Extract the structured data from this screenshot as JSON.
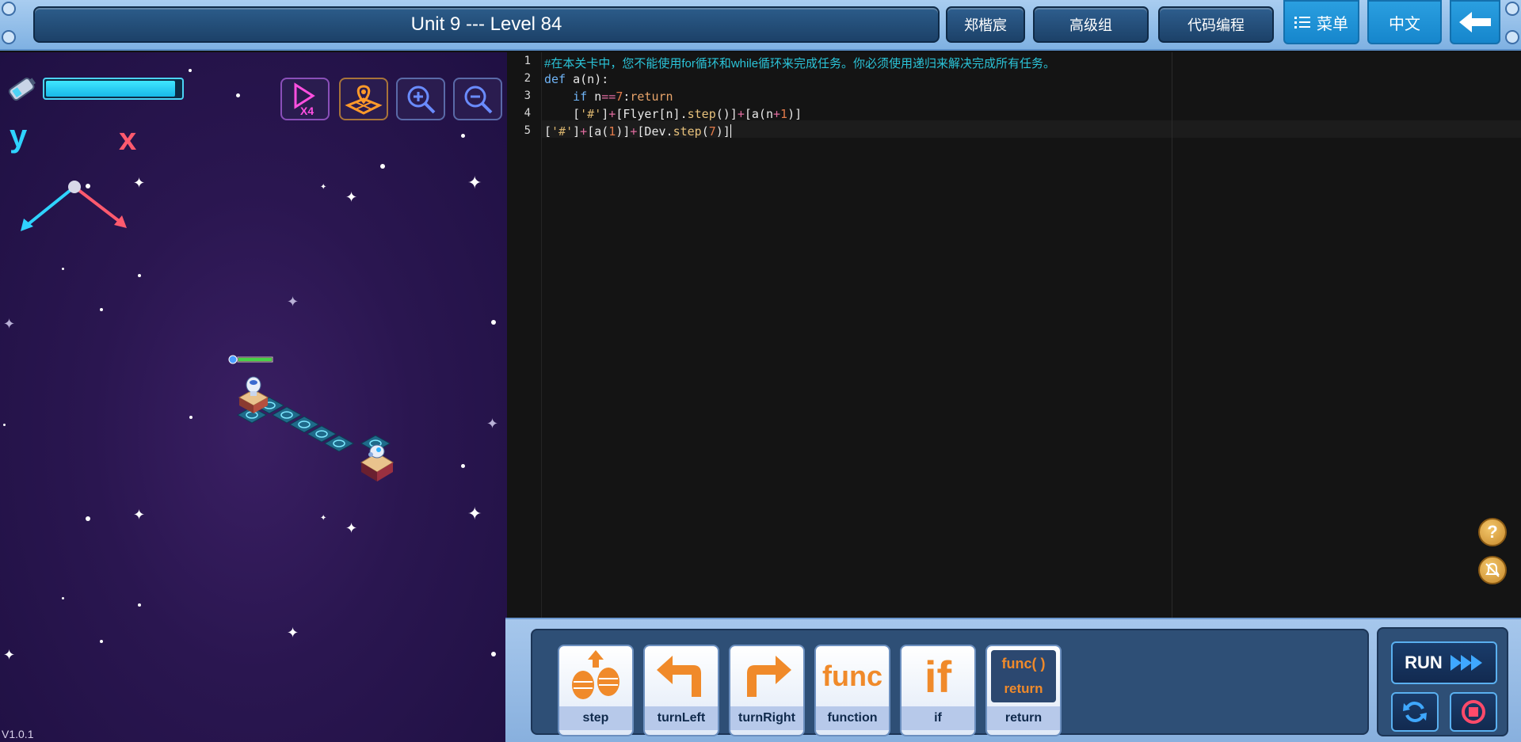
{
  "header": {
    "title": "Unit 9 --- Level 84",
    "user_name": "郑楷宸",
    "group": "高级组",
    "mode": "代码编程",
    "menu_label": "菜单",
    "language": "中文",
    "back_icon": "arrow-left-icon"
  },
  "game": {
    "energy_level": 0.96,
    "axis_y_label": "y",
    "axis_x_label": "x",
    "tools": [
      {
        "name": "play-speed",
        "icon": "play-x4-icon",
        "text": "X4"
      },
      {
        "name": "map-view",
        "icon": "map-pin-icon"
      },
      {
        "name": "zoom-in",
        "icon": "zoom-in-icon"
      },
      {
        "name": "zoom-out",
        "icon": "zoom-out-icon"
      }
    ],
    "version": "V1.0.1"
  },
  "editor": {
    "line_numbers": [
      "1",
      "2",
      "3",
      "4",
      "5"
    ],
    "lines": [
      "#在本关卡中，您不能使用for循环和while循环来完成任务。你必须使用递归来解决完成所有任务。",
      "def a(n):",
      "    if n==7:return",
      "    ['#']+[Flyer[n].step()]+[a(n+1)]",
      "['#']+[a(1)]+[Dev.step(7)]"
    ],
    "help_icon": "question-icon",
    "mute_icon": "bell-off-icon"
  },
  "commands": [
    {
      "label": "step",
      "icon": "footsteps-icon"
    },
    {
      "label": "turnLeft",
      "icon": "turn-left-arrow-icon"
    },
    {
      "label": "turnRight",
      "icon": "turn-right-arrow-icon"
    },
    {
      "label": "function",
      "icon": "func-text-icon",
      "icon_text": "func"
    },
    {
      "label": "if",
      "icon": "if-text-icon",
      "icon_text": "if"
    },
    {
      "label": "return",
      "icon": "func-return-icon",
      "icon_text": "func( )",
      "icon_text2": "return"
    }
  ],
  "controls": {
    "run_label": "RUN",
    "run_icon": "fast-forward-icon",
    "reset_icon": "refresh-icon",
    "stop_icon": "stop-icon"
  },
  "colors": {
    "accent": "#1686cc",
    "game_bg": "#2a1650",
    "editor_bg": "#141414",
    "comment": "#2bc4d8",
    "energy": "#3fe6ff"
  }
}
